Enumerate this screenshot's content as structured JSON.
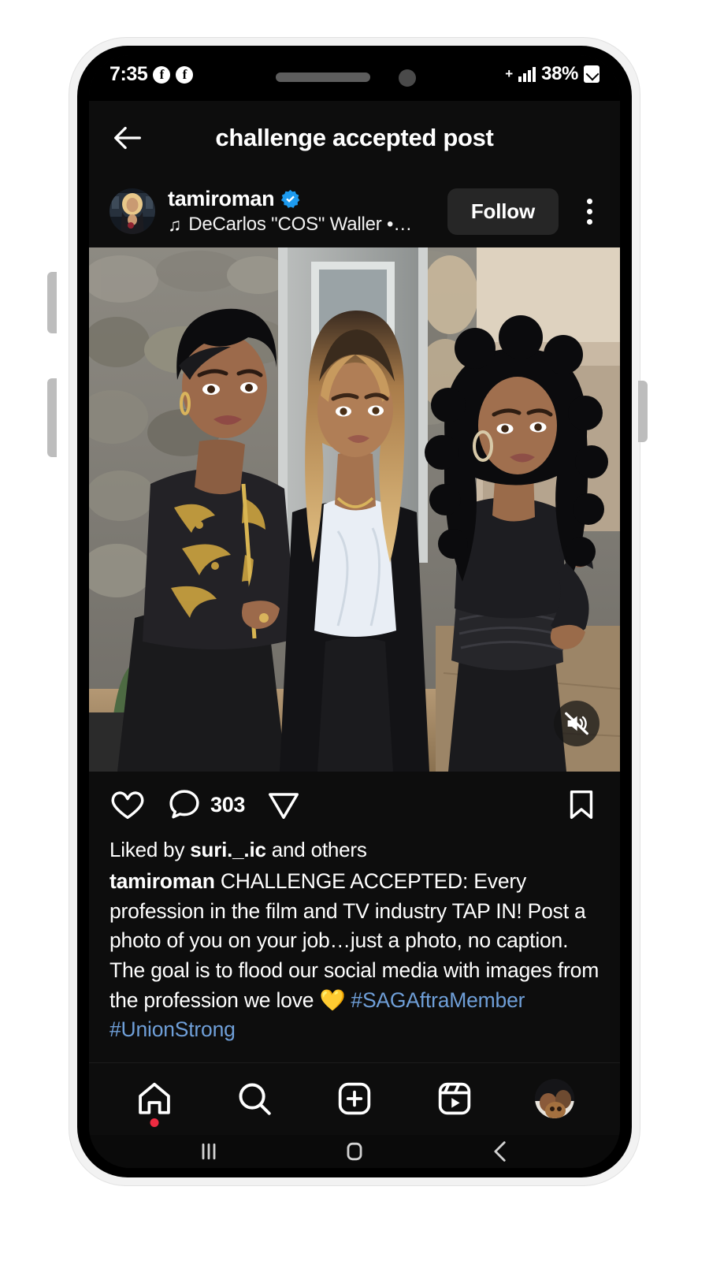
{
  "status_bar": {
    "time": "7:35",
    "app_badge_1": "f",
    "app_badge_2": "f",
    "signal_plus": "+",
    "battery_percent": "38%"
  },
  "app_header": {
    "title": "challenge accepted post",
    "back_icon": "back-arrow-icon"
  },
  "post_header": {
    "username": "tamiroman",
    "verified": true,
    "audio_attribution": "DeCarlos \"COS\" Waller •…",
    "music_icon": "♫",
    "follow_label": "Follow",
    "more_icon": "more-options-icon"
  },
  "media": {
    "mute_icon": "speaker-muted-icon",
    "alt": "Three women posing in front of a stone house entrance"
  },
  "actions": {
    "like_icon": "heart-icon",
    "comment_icon": "comment-icon",
    "comment_count": "303",
    "share_icon": "share-icon",
    "save_icon": "bookmark-icon"
  },
  "caption": {
    "liked_by_prefix": "Liked by ",
    "liked_by_user": "suri._.ic",
    "liked_by_suffix": " and others",
    "author": "tamiroman",
    "body": " CHALLENGE ACCEPTED: Every profession in the film and TV industry TAP IN! Post a photo of you on your job…just a photo, no caption. The goal is to flood our social media with images from the profession we love 💛 ",
    "hashtag_1": "#SAGAftraMember",
    "hashtag_2": "#UnionStrong"
  },
  "bottom_nav": {
    "items": [
      {
        "name": "home",
        "icon": "home-icon",
        "has_badge": true
      },
      {
        "name": "search",
        "icon": "search-icon",
        "has_badge": false
      },
      {
        "name": "create",
        "icon": "plus-square-icon",
        "has_badge": false
      },
      {
        "name": "reels",
        "icon": "reels-icon",
        "has_badge": false
      },
      {
        "name": "profile",
        "icon": "profile-avatar-icon",
        "has_badge": false
      }
    ]
  },
  "system_nav": {
    "recents_icon": "recents-icon",
    "home_icon": "home-square-icon",
    "back_icon": "back-chevron-icon"
  },
  "colors": {
    "app_background": "#0d0d0d",
    "verified_blue": "#1d9bf0",
    "hashtag_blue": "#6f9fd8",
    "follow_button": "#262626",
    "badge_red": "#ed2b41"
  }
}
